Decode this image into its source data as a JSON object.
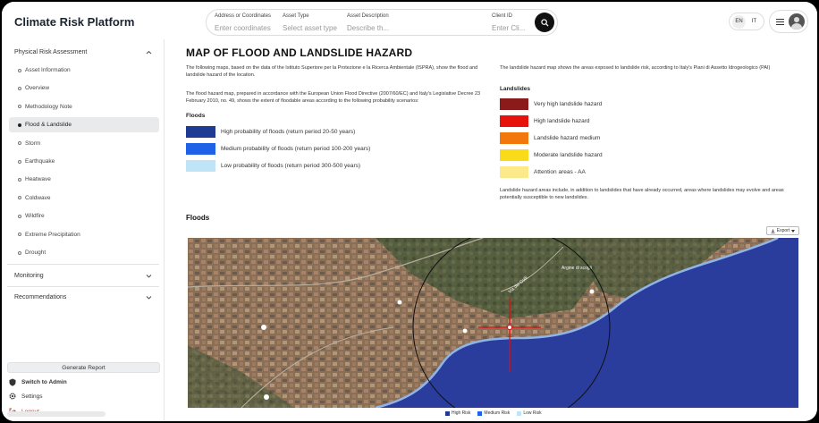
{
  "app": {
    "title": "Climate Risk Platform"
  },
  "search": {
    "fields": [
      {
        "label": "Address or Coordinates",
        "placeholder": "Enter coordinates"
      },
      {
        "label": "Asset Type",
        "placeholder": "Select asset type"
      },
      {
        "label": "Asset Description",
        "placeholder": "Describe th..."
      },
      {
        "label": "Client ID",
        "placeholder": "Enter Cli..."
      }
    ]
  },
  "lang": {
    "en": "EN",
    "it": "IT"
  },
  "sidebar": {
    "physical": {
      "title": "Physical Risk Assessment",
      "items": [
        {
          "label": "Asset Information"
        },
        {
          "label": "Overview"
        },
        {
          "label": "Methodology Note"
        },
        {
          "label": "Flood & Landslide"
        },
        {
          "label": "Storm"
        },
        {
          "label": "Earthquake"
        },
        {
          "label": "Heatwave"
        },
        {
          "label": "Coldwave"
        },
        {
          "label": "Wildfire"
        },
        {
          "label": "Extreme Precipitation"
        },
        {
          "label": "Drought"
        }
      ]
    },
    "monitoring": "Monitoring",
    "recommendations": "Recommendations",
    "generate": "Generate Report",
    "switch_admin": "Switch to Admin",
    "settings": "Settings",
    "logout": "Logout"
  },
  "main": {
    "title": "MAP OF FLOOD AND LANDSLIDE HAZARD",
    "intro": "The following maps, based on the data of the Istituto Superiore per la Protezione e la Ricerca Ambientale (ISPRA), show the flood and landslide hazard of the location.",
    "flood_desc": "The flood hazard map, prepared in accordance with the European Union Flood Directive (2007/60/EC) and Italy's Legislative Decree 23 February 2010, no. 49, shows the extent of floodable areas according to the following probability scenarios:",
    "floods_label": "Floods",
    "flood_legend": [
      {
        "label": "High probability of floods (return period 20-50 years)",
        "color": "#1f3a93"
      },
      {
        "label": "Medium probability of floods (return period 100-200 years)",
        "color": "#1f62e8"
      },
      {
        "label": "Low probability of floods (return period 300-500 years)",
        "color": "#bfe3f7"
      }
    ],
    "landslide_desc": "The landslide hazard map shows the areas exposed to landslide risk, according to Italy's Piani di Assetto Idrogeologico (PAI)",
    "landslides_label": "Landslides",
    "landslide_legend": [
      {
        "label": "Very high landslide hazard",
        "color": "#8b1a1a"
      },
      {
        "label": "High landslide hazard",
        "color": "#e8120c"
      },
      {
        "label": "Landslide hazard medium",
        "color": "#f2780c"
      },
      {
        "label": "Moderate landslide hazard",
        "color": "#fadb1a"
      },
      {
        "label": "Attention areas - AA",
        "color": "#fbe98a"
      }
    ],
    "landslide_note": "Landslide hazard areas include, in addition to landslides that have already occurred, areas where landslides may evolve and areas potentially susceptible to new landslides.",
    "floods_map_title": "Floods",
    "export": "Export",
    "map_labels": {
      "street": "Via dei Colli",
      "place": "Argine di scogli"
    },
    "map_legend": [
      {
        "label": "High Risk",
        "color": "#1f3a93"
      },
      {
        "label": "Medium Risk",
        "color": "#1f62e8"
      },
      {
        "label": "Low Risk",
        "color": "#bfe3f7"
      }
    ]
  }
}
